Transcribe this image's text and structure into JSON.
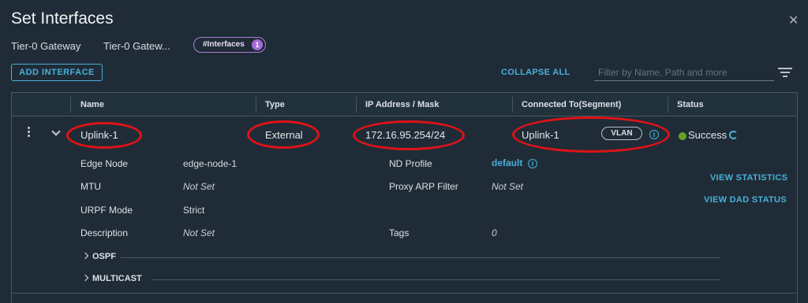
{
  "dialog": {
    "title": "Set Interfaces",
    "close_icon": "close-icon"
  },
  "breadcrumbs": [
    "Tier-0 Gateway",
    "Tier-0 Gatew..."
  ],
  "interfaces_pill": {
    "label": "#Interfaces",
    "count": "1"
  },
  "toolbar": {
    "add_label": "ADD INTERFACE",
    "collapse_label": "COLLAPSE ALL",
    "filter_placeholder": "Filter by Name, Path and more",
    "filter_icon": "filter-lines-icon"
  },
  "columns": [
    "Name",
    "Type",
    "IP Address / Mask",
    "Connected To(Segment)",
    "Status"
  ],
  "row": {
    "name": "Uplink-1",
    "type": "External",
    "ip": "172.16.95.254/24",
    "segment": "Uplink-1",
    "segment_badge": "VLAN",
    "status": "Success"
  },
  "details": {
    "edge_node_label": "Edge Node",
    "edge_node_value": "edge-node-1",
    "mtu_label": "MTU",
    "mtu_value": "Not Set",
    "urpf_label": "URPF Mode",
    "urpf_value": "Strict",
    "description_label": "Description",
    "description_value": "Not Set",
    "nd_profile_label": "ND Profile",
    "nd_profile_value": "default",
    "proxy_arp_label": "Proxy ARP Filter",
    "proxy_arp_value": "Not Set",
    "tags_label": "Tags",
    "tags_value": "0",
    "view_statistics": "VIEW STATISTICS",
    "view_dad_status": "VIEW DAD STATUS"
  },
  "sections": [
    "OSPF",
    "MULTICAST"
  ],
  "colors": {
    "background": "#1f2c37",
    "accent": "#49afd9",
    "success": "#62a420",
    "annotation": "#e01218",
    "pill": "#a46bd6"
  }
}
